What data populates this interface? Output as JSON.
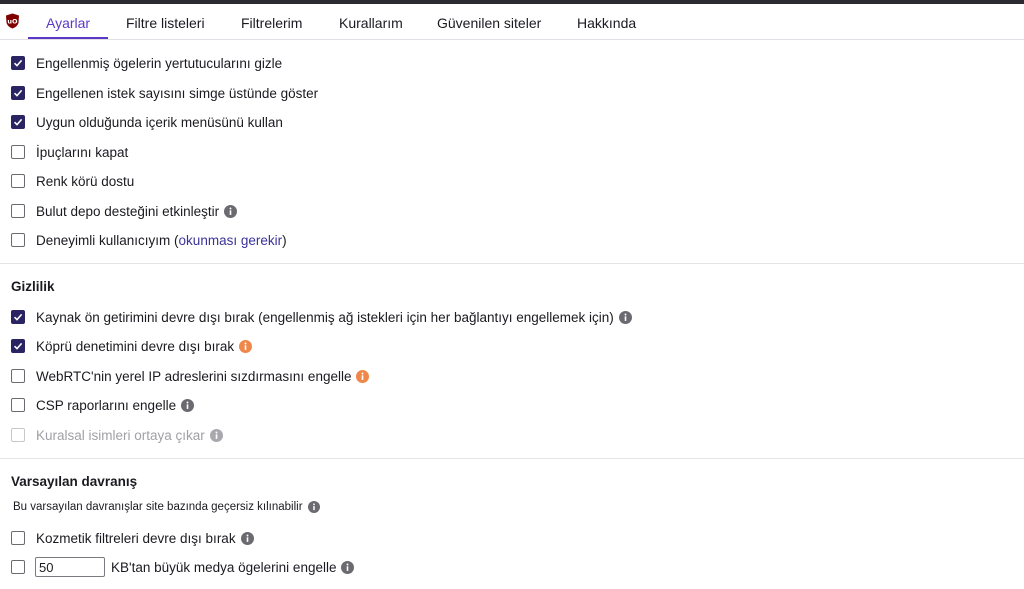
{
  "tabs": [
    {
      "label": "Ayarlar",
      "active": true
    },
    {
      "label": "Filtre listeleri"
    },
    {
      "label": "Filtrelerim"
    },
    {
      "label": "Kurallarım"
    },
    {
      "label": "Güvenilen siteler"
    },
    {
      "label": "Hakkında"
    }
  ],
  "general": {
    "items": [
      {
        "label": "Engellenmiş ögelerin yertutucularını gizle",
        "checked": true
      },
      {
        "label": "Engellenen istek sayısını simge üstünde göster",
        "checked": true
      },
      {
        "label": "Uygun olduğunda içerik menüsünü kullan",
        "checked": true
      },
      {
        "label": "İpuçlarını kapat",
        "checked": false
      },
      {
        "label": "Renk körü dostu",
        "checked": false
      },
      {
        "label": "Bulut depo desteğini etkinleştir",
        "checked": false,
        "info": "info-icon"
      },
      {
        "label_prefix": "Deneyimli kullanıcıyım (",
        "label_link": "okunması gerekir",
        "label_suffix": ")",
        "checked": false
      }
    ]
  },
  "privacy": {
    "title": "Gizlilik",
    "items": [
      {
        "label": "Kaynak ön getirimini devre dışı bırak (engellenmiş ağ istekleri için her bağlantıyı engellemek için)",
        "checked": true,
        "info": "info-icon"
      },
      {
        "label": "Köprü denetimini devre dışı bırak",
        "checked": true,
        "info": "warning-info-icon"
      },
      {
        "label": "WebRTC'nin yerel IP adreslerini sızdırmasını engelle",
        "checked": false,
        "info": "warning-info-icon"
      },
      {
        "label": "CSP raporlarını engelle",
        "checked": false,
        "info": "info-icon"
      },
      {
        "label": "Kuralsal isimleri ortaya çıkar",
        "checked": false,
        "disabled": true,
        "info": "info-icon"
      }
    ]
  },
  "defaults": {
    "title": "Varsayılan davranış",
    "note": "Bu varsayılan davranışlar site bazında geçersiz kılınabilir",
    "cosmetic_label": "Kozmetik filtreleri devre dışı bırak",
    "cosmetic_checked": false,
    "media_checked": false,
    "media_value": "50",
    "media_label": "KB'tan büyük medya ögelerini engelle"
  },
  "colors": {
    "accent": "#5b39c5",
    "checkbox_checked": "#2a2462",
    "info_gray": "#6a6a70",
    "info_orange": "#f0874a"
  }
}
